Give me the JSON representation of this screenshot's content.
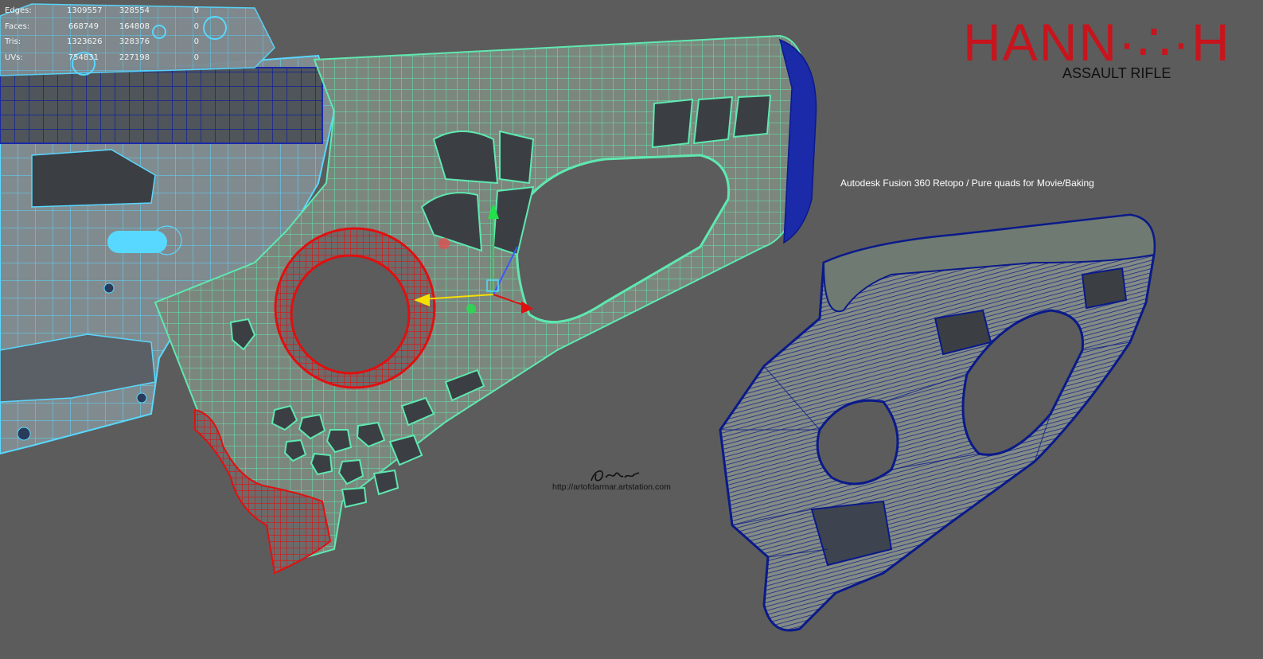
{
  "hud": {
    "rows": [
      {
        "label": "Edges:",
        "v1": "1309557",
        "v2": "328554",
        "v3": "0"
      },
      {
        "label": "Faces:",
        "v1": "668749",
        "v2": "164808",
        "v3": "0"
      },
      {
        "label": "Tris:",
        "v1": "1323626",
        "v2": "328376",
        "v3": "0"
      },
      {
        "label": "UVs:",
        "v1": "754831",
        "v2": "227198",
        "v3": "0"
      }
    ]
  },
  "logo": {
    "title": "HANN·∴·H",
    "title_display": "HANNAH",
    "subtitle": "ASSAULT RIFLE",
    "color": "#c8141c"
  },
  "caption": "Autodesk Fusion 360 Retopo / Pure quads for Movie/Baking",
  "signature": {
    "url": "http://artofdarmar.artstation.com"
  },
  "colors": {
    "background": "#5c5c5c",
    "mesh_green": "#5fe8b0",
    "mesh_red": "#e01010",
    "mesh_blue_wire": "#0a1a8a",
    "mesh_cyan": "#58d8ff",
    "body_fill": "#7f8a7f"
  },
  "icons": [
    "move-gizmo-icon"
  ]
}
